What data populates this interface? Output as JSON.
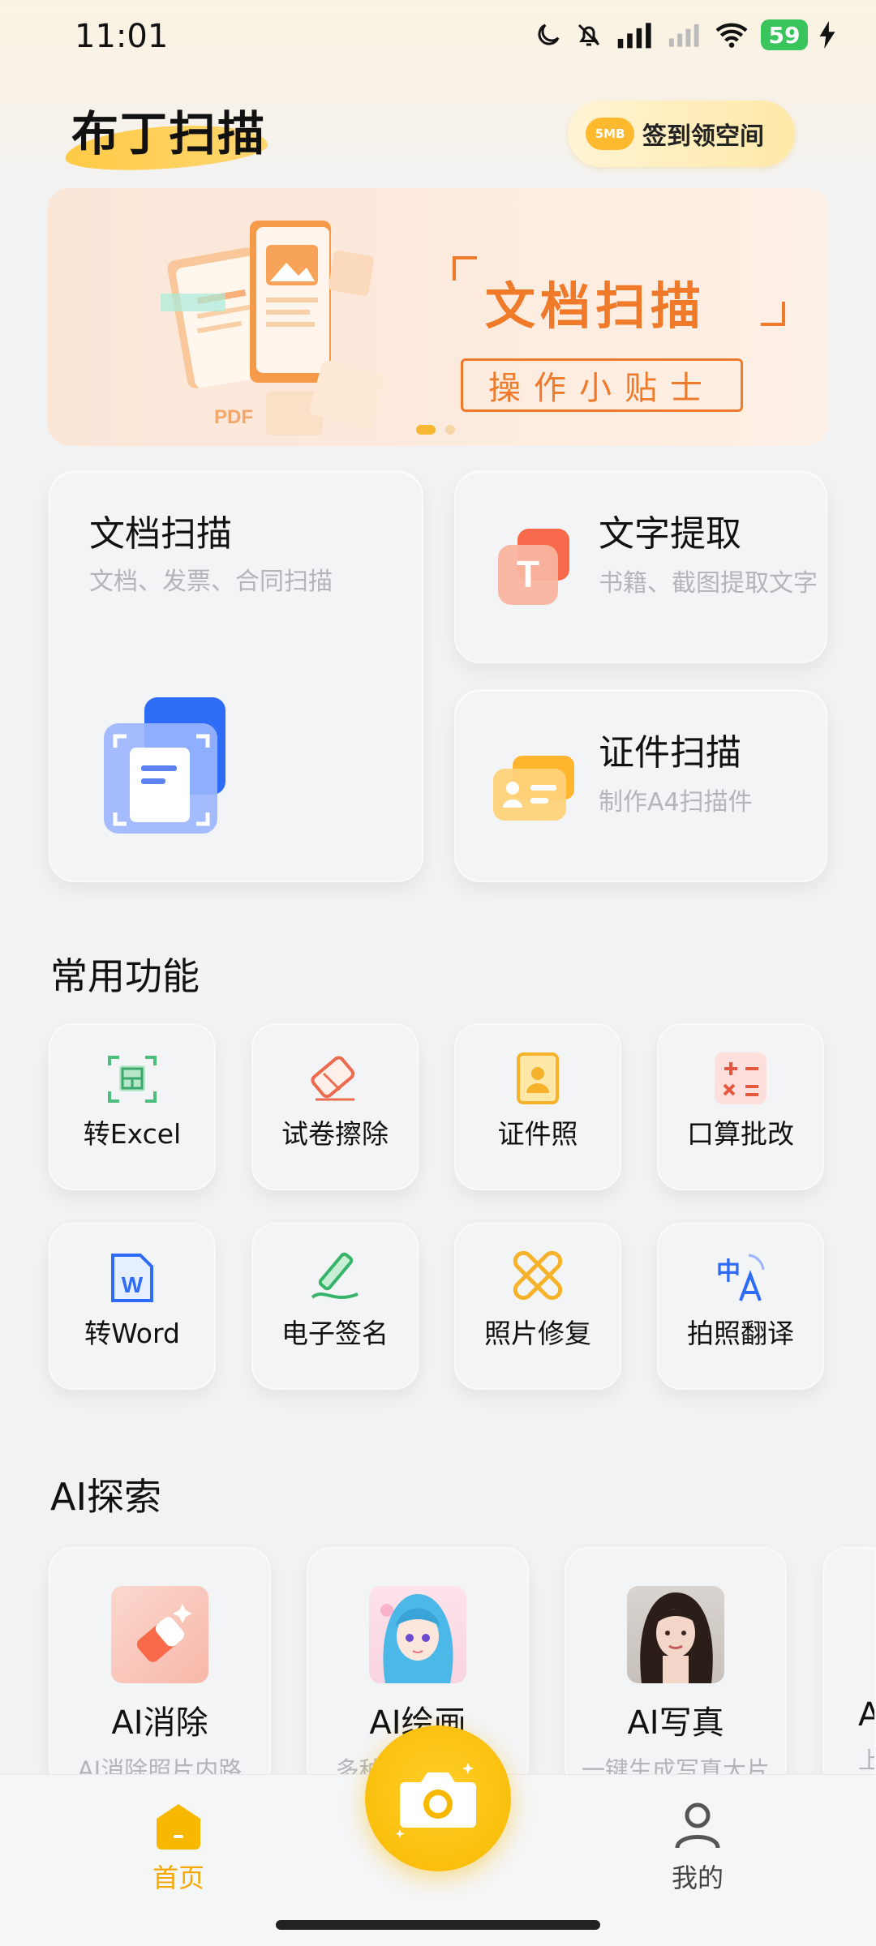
{
  "status_bar": {
    "time": "11:01",
    "battery": "59"
  },
  "header": {
    "app_title": "布丁扫描",
    "checkin_badge": "5MB",
    "checkin_label": "签到领空间"
  },
  "banner": {
    "title": "文档扫描",
    "subtitle": "操作小贴士",
    "pdf_label": "PDF"
  },
  "features": {
    "doc_scan": {
      "title": "文档扫描",
      "subtitle": "文档、发票、合同扫描"
    },
    "text_extract": {
      "title": "文字提取",
      "subtitle": "书籍、截图提取文字",
      "icon_letter": "T"
    },
    "id_scan": {
      "title": "证件扫描",
      "subtitle": "制作A4扫描件"
    }
  },
  "common": {
    "title": "常用功能",
    "items": [
      {
        "label": "转Excel",
        "icon": "excel-icon"
      },
      {
        "label": "试卷擦除",
        "icon": "eraser-icon"
      },
      {
        "label": "证件照",
        "icon": "id-photo-icon"
      },
      {
        "label": "口算批改",
        "icon": "calculator-icon"
      },
      {
        "label": "转Word",
        "icon": "word-icon",
        "icon_letter": "W"
      },
      {
        "label": "电子签名",
        "icon": "signature-icon"
      },
      {
        "label": "照片修复",
        "icon": "photo-repair-icon"
      },
      {
        "label": "拍照翻译",
        "icon": "translate-icon",
        "icon_text": "中"
      }
    ]
  },
  "ai": {
    "title": "AI探索",
    "items": [
      {
        "title": "AI消除",
        "subtitle": "AI消除照片内路"
      },
      {
        "title": "AI绘画",
        "subtitle": "多种风格随心画"
      },
      {
        "title": "AI写真",
        "subtitle": "一键生成写真大片"
      },
      {
        "title": "A",
        "subtitle": "上传"
      }
    ]
  },
  "nav": {
    "home": "首页",
    "mine": "我的"
  },
  "colors": {
    "accent": "#f8b800",
    "banner_orange": "#ef7a2a"
  }
}
